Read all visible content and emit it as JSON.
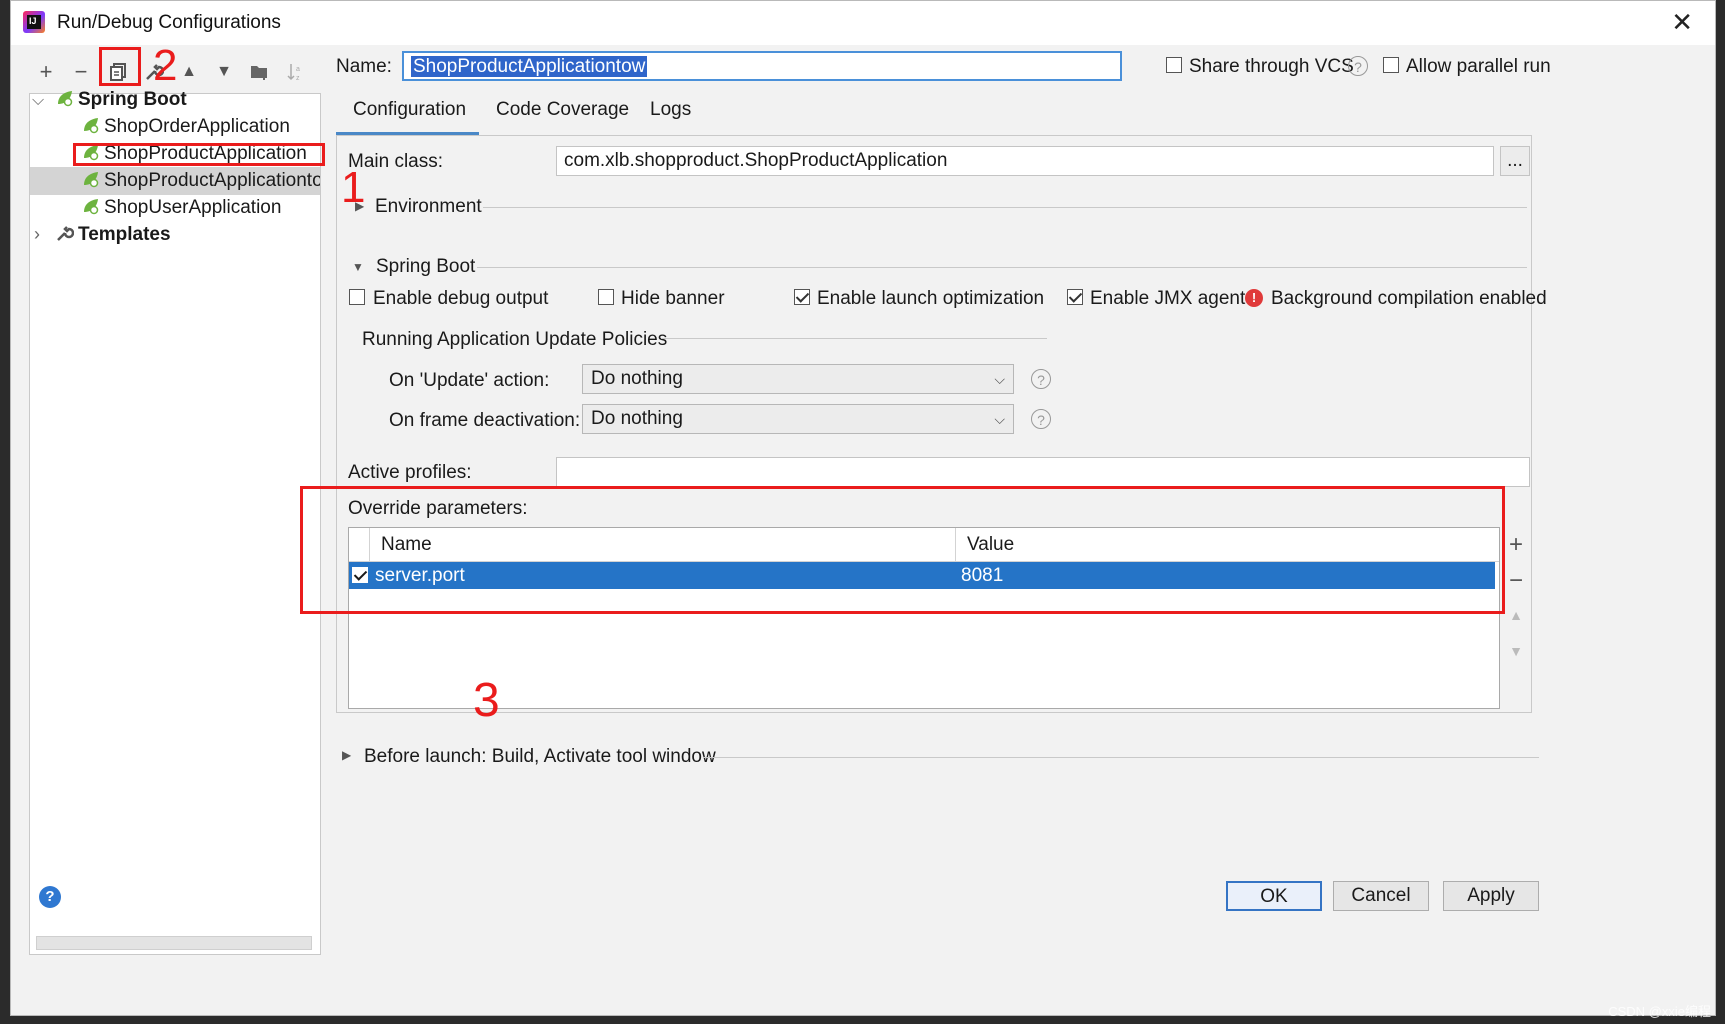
{
  "window": {
    "title": "Run/Debug Configurations",
    "close_glyph": "✕"
  },
  "toolbar": {
    "add_glyph": "+",
    "remove_glyph": "−",
    "copy_icon": "copy-icon",
    "edit_templates_icon": "wrench-icon",
    "move_up_glyph": "▲",
    "move_down_glyph": "▼",
    "folder_icon": "folder-icon",
    "sort_icon": "sort-icon"
  },
  "tree": {
    "group_label": "Spring Boot",
    "items": [
      {
        "label": "ShopOrderApplication"
      },
      {
        "label": "ShopProductApplication"
      },
      {
        "label": "ShopProductApplicationtow"
      },
      {
        "label": "ShopUserApplication"
      }
    ],
    "templates_label": "Templates"
  },
  "header": {
    "name_label": "Name:",
    "name_value": "ShopProductApplicationtow",
    "share_vcs_label": "Share through VCS",
    "allow_parallel_label": "Allow parallel run"
  },
  "tabs": [
    {
      "label": "Configuration"
    },
    {
      "label": "Code Coverage"
    },
    {
      "label": "Logs"
    }
  ],
  "config": {
    "main_class_label": "Main class:",
    "main_class_value": "com.xlb.shopproduct.ShopProductApplication",
    "browse_label": "...",
    "environment_label": "Environment",
    "spring_boot_label": "Spring Boot",
    "options": {
      "enable_debug_output": "Enable debug output",
      "hide_banner": "Hide banner",
      "enable_launch_optimization": "Enable launch optimization",
      "enable_jmx_agent": "Enable JMX agent",
      "background_compilation": "Background compilation enabled"
    },
    "update_policies_label": "Running Application Update Policies",
    "on_update_label": "On 'Update' action:",
    "on_update_value": "Do nothing",
    "on_frame_label": "On frame deactivation:",
    "on_frame_value": "Do nothing",
    "active_profiles_label": "Active profiles:",
    "active_profiles_value": "",
    "override_label": "Override parameters:",
    "table": {
      "columns": [
        "Name",
        "Value"
      ],
      "rows": [
        {
          "name": "server.port",
          "value": "8081",
          "enabled": true
        }
      ]
    },
    "side_buttons": {
      "add": "+",
      "remove": "−",
      "up": "▲",
      "down": "▼"
    }
  },
  "before_launch_label": "Before launch: Build, Activate tool window",
  "buttons": {
    "ok": "OK",
    "cancel": "Cancel",
    "apply": "Apply",
    "help": "?"
  },
  "annotations": {
    "one": "1",
    "two": "2",
    "three": "3"
  },
  "watermark": "CSDN @xxie编程",
  "colors": {
    "accent": "#2574c7",
    "annotation_red": "#ea1c1c",
    "spring_green": "#6db33f"
  }
}
